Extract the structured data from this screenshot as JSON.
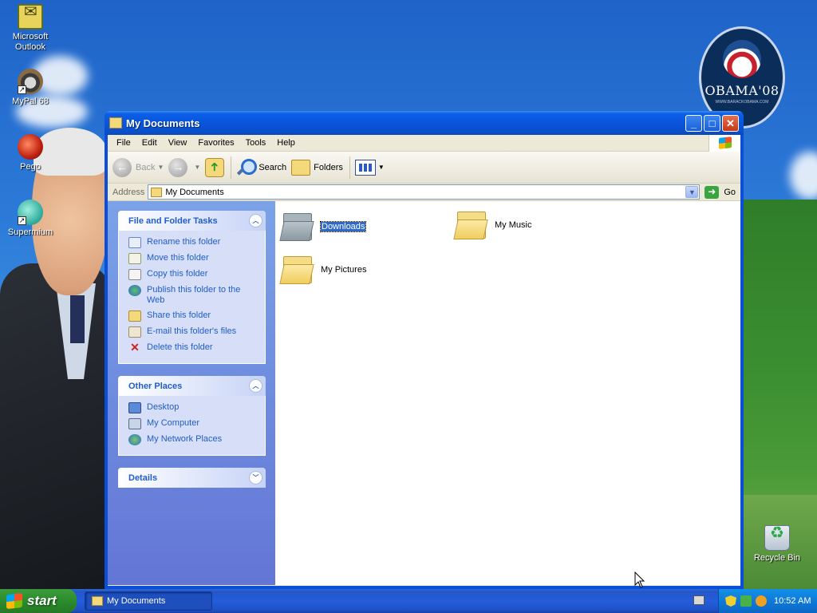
{
  "desktop": {
    "icons": [
      {
        "label": "Microsoft Outlook",
        "icon": "outlook-icon"
      },
      {
        "label": "MyPal 68",
        "icon": "mypal-icon"
      },
      {
        "label": "Pego",
        "icon": "pego-icon"
      },
      {
        "label": "Supermium",
        "icon": "supermium-icon"
      },
      {
        "label": "Recycle Bin",
        "icon": "recycle-bin-icon"
      }
    ],
    "badge": {
      "title": "OBAMA'08",
      "subtitle": "WWW.BARACKOBAMA.COM"
    }
  },
  "window": {
    "title": "My Documents",
    "menu": [
      "File",
      "Edit",
      "View",
      "Favorites",
      "Tools",
      "Help"
    ],
    "toolbar": {
      "back": "Back",
      "search": "Search",
      "folders": "Folders"
    },
    "address": {
      "label": "Address",
      "value": "My Documents",
      "go": "Go"
    },
    "tasks_panel": {
      "title": "File and Folder Tasks",
      "items": [
        "Rename this folder",
        "Move this folder",
        "Copy this folder",
        "Publish this folder to the Web",
        "Share this folder",
        "E-mail this folder's files",
        "Delete this folder"
      ]
    },
    "places_panel": {
      "title": "Other Places",
      "items": [
        "Desktop",
        "My Computer",
        "My Network Places"
      ]
    },
    "details_panel": {
      "title": "Details"
    },
    "files": [
      {
        "name": "Downloads",
        "selected": true
      },
      {
        "name": "My Music",
        "selected": false
      },
      {
        "name": "My Pictures",
        "selected": false
      }
    ]
  },
  "taskbar": {
    "start": "start",
    "task": "My Documents",
    "clock": "10:52 AM"
  },
  "colors": {
    "link": "#215dc6",
    "selection": "#316ac5",
    "titlebar": "#0a55dc"
  }
}
